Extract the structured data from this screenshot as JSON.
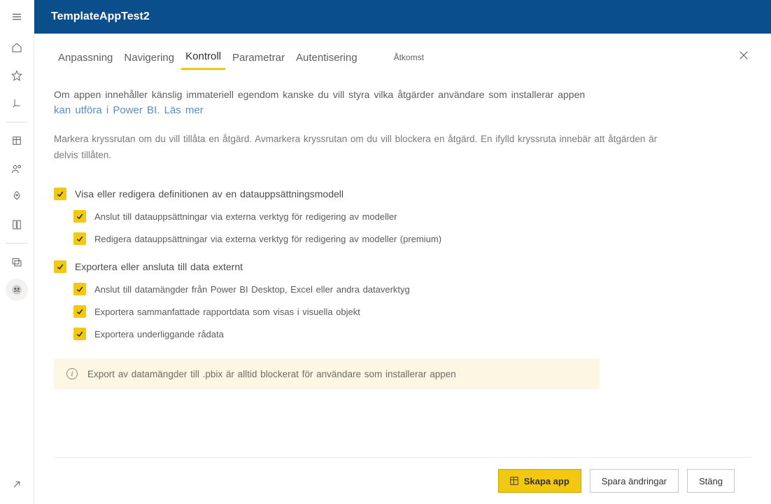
{
  "header": {
    "title": "TemplateAppTest2"
  },
  "tabs": {
    "items": [
      {
        "label": "Anpassning"
      },
      {
        "label": "Navigering"
      },
      {
        "label": "Kontroll"
      },
      {
        "label": "Parametrar"
      },
      {
        "label": "Autentisering"
      }
    ],
    "extra": {
      "label": "Åtkomst"
    },
    "active_index": 2
  },
  "description": {
    "text": "Om appen innehåller känslig immateriell egendom kanske du vill styra vilka åtgärder användare som installerar appen",
    "link_text": "kan utföra i Power BI. Läs mer",
    "sub": "Markera kryssrutan om du vill tillåta en åtgärd. Avmarkera kryssrutan om du vill blockera en åtgärd. En ifylld kryssruta innebär att åtgärden är delvis tillåten."
  },
  "controls": {
    "group1": {
      "label": "Visa eller redigera definitionen av en datauppsättningsmodell",
      "checked": true,
      "children": [
        {
          "label": "Anslut till datauppsättningar via externa verktyg för redigering av modeller",
          "checked": true
        },
        {
          "label": "Redigera datauppsättningar via externa verktyg för redigering av modeller (premium)",
          "checked": true
        }
      ]
    },
    "group2": {
      "label": "Exportera eller ansluta till data externt",
      "checked": true,
      "children": [
        {
          "label": "Anslut till datamängder från Power BI Desktop, Excel eller andra dataverktyg",
          "checked": true
        },
        {
          "label": "Exportera sammanfattade rapportdata som visas i visuella objekt",
          "checked": true
        },
        {
          "label": "Exportera underliggande rådata",
          "checked": true
        }
      ]
    }
  },
  "banner": {
    "text": "Export av datamängder till .pbix är alltid blockerat för användare som installerar appen"
  },
  "footer": {
    "create": "Skapa app",
    "save": "Spara ändringar",
    "close": "Stäng"
  },
  "colors": {
    "accent": "#f2c811",
    "brand": "#0a4e8c",
    "link": "#5a8dc4"
  }
}
